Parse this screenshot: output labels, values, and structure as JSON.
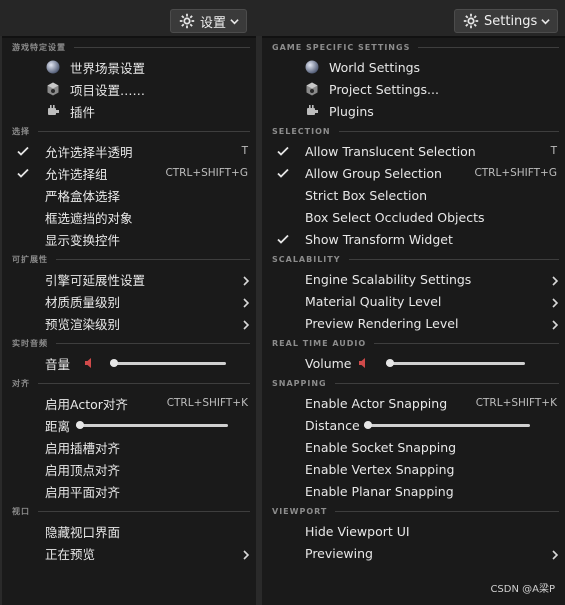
{
  "colors": {
    "panel_bg": "#1a1a1a",
    "text": "#e8e8e8",
    "section": "#8c8c8c",
    "speaker": "#d04a4a"
  },
  "zh": {
    "button_label": "设置",
    "sections": [
      {
        "title": "游戏特定设置",
        "items": [
          {
            "label": "世界场景设置",
            "icon": "globe-icon"
          },
          {
            "label": "项目设置……",
            "icon": "project-settings-icon"
          },
          {
            "label": "插件",
            "icon": "plugin-icon"
          }
        ]
      },
      {
        "title": "选择",
        "items": [
          {
            "label": "允许选择半透明",
            "checked": true,
            "shortcut": "T"
          },
          {
            "label": "允许选择组",
            "checked": true,
            "shortcut": "CTRL+SHIFT+G"
          },
          {
            "label": "严格盒体选择"
          },
          {
            "label": "框选遮挡的对象"
          },
          {
            "label": "显示变换控件"
          }
        ]
      },
      {
        "title": "可扩展性",
        "items": [
          {
            "label": "引擎可延展性设置",
            "submenu": true
          },
          {
            "label": "材质质量级别",
            "submenu": true
          },
          {
            "label": "预览渲染级别",
            "submenu": true
          }
        ]
      },
      {
        "title": "实时音频",
        "items": [
          {
            "label": "音量",
            "slider": "volume",
            "value": 0.0
          }
        ]
      },
      {
        "title": "对齐",
        "items": [
          {
            "label": "启用Actor对齐",
            "shortcut": "CTRL+SHIFT+K"
          },
          {
            "label": "距离",
            "slider": "distance",
            "value": 0.0
          },
          {
            "label": "启用插槽对齐"
          },
          {
            "label": "启用顶点对齐"
          },
          {
            "label": "启用平面对齐"
          }
        ]
      },
      {
        "title": "视口",
        "items": [
          {
            "label": "隐藏视口界面"
          },
          {
            "label": "正在预览",
            "submenu": true
          }
        ]
      }
    ]
  },
  "en": {
    "button_label": "Settings",
    "sections": [
      {
        "title": "GAME SPECIFIC SETTINGS",
        "items": [
          {
            "label": "World Settings",
            "icon": "globe-icon"
          },
          {
            "label": "Project Settings...",
            "icon": "project-settings-icon"
          },
          {
            "label": "Plugins",
            "icon": "plugin-icon"
          }
        ]
      },
      {
        "title": "SELECTION",
        "items": [
          {
            "label": "Allow Translucent Selection",
            "checked": true,
            "shortcut": "T"
          },
          {
            "label": "Allow Group Selection",
            "checked": true,
            "shortcut": "CTRL+SHIFT+G"
          },
          {
            "label": "Strict Box Selection"
          },
          {
            "label": "Box Select Occluded Objects"
          },
          {
            "label": "Show Transform Widget",
            "checked": true
          }
        ]
      },
      {
        "title": "SCALABILITY",
        "items": [
          {
            "label": "Engine Scalability Settings",
            "submenu": true
          },
          {
            "label": "Material Quality Level",
            "submenu": true
          },
          {
            "label": "Preview Rendering Level",
            "submenu": true
          }
        ]
      },
      {
        "title": "REAL TIME AUDIO",
        "items": [
          {
            "label": "Volume",
            "slider": "volume",
            "value": 0.0
          }
        ]
      },
      {
        "title": "SNAPPING",
        "items": [
          {
            "label": "Enable Actor Snapping",
            "shortcut": "CTRL+SHIFT+K"
          },
          {
            "label": "Distance",
            "slider": "distance",
            "value": 0.0
          },
          {
            "label": "Enable Socket Snapping"
          },
          {
            "label": "Enable Vertex Snapping"
          },
          {
            "label": "Enable Planar Snapping"
          }
        ]
      },
      {
        "title": "VIEWPORT",
        "items": [
          {
            "label": "Hide Viewport UI"
          },
          {
            "label": "Previewing",
            "submenu": true
          }
        ]
      }
    ]
  },
  "watermark": "CSDN @A梁P"
}
